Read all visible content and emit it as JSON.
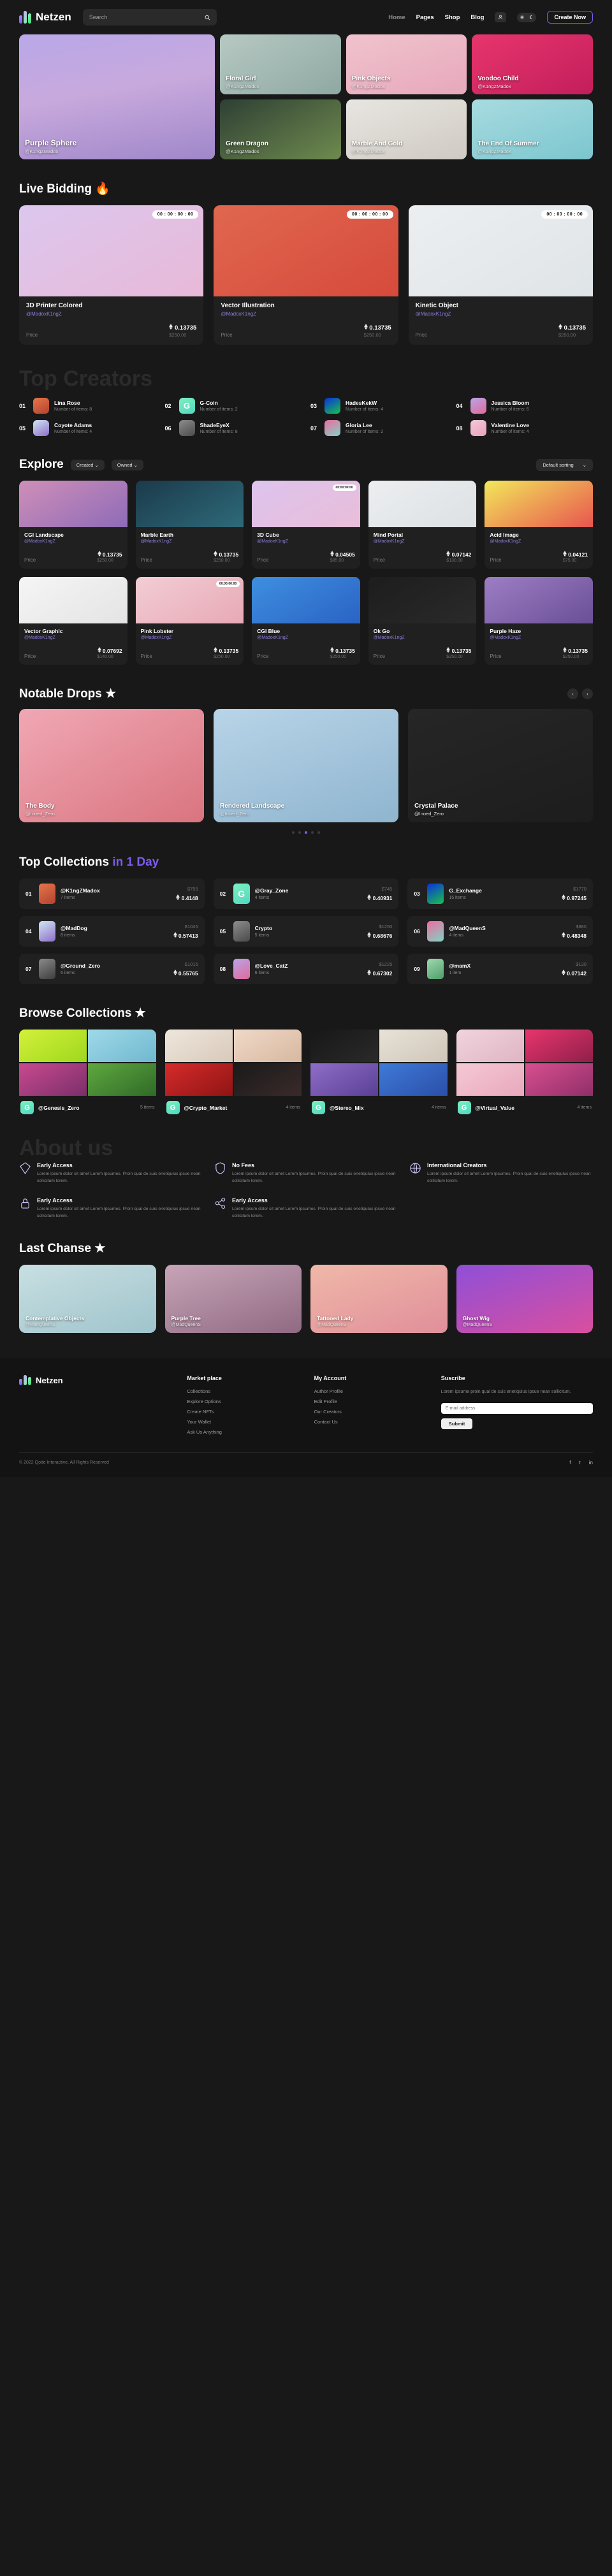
{
  "brand": {
    "name": "Netzen"
  },
  "search": {
    "placeholder": "Search",
    "value": "",
    "icon": "search-icon"
  },
  "nav": {
    "items": [
      {
        "label": "Home",
        "active": true
      },
      {
        "label": "Pages"
      },
      {
        "label": "Shop"
      },
      {
        "label": "Blog"
      }
    ],
    "user_icon": "user-icon",
    "theme_sun": "☀",
    "theme_moon": "☾",
    "cta": "Create Now"
  },
  "hero": {
    "cards": [
      {
        "title": "Purple Sphere",
        "author": "@K1ngZMadox",
        "bg": "linear-gradient(170deg,#b9a8e8,#c8a9dd 45%,#9f87c9)"
      },
      {
        "title": "Floral Girl",
        "author": "@K1ngZMadox",
        "bg": "linear-gradient(150deg,#b7c9c2,#8fa8a3)"
      },
      {
        "title": "Pink Objects",
        "author": "@K1ngZMadox",
        "bg": "linear-gradient(160deg,#f0c3ce,#e7a8bb)"
      },
      {
        "title": "Voodoo Child",
        "author": "@K1ngZMadox",
        "bg": "linear-gradient(150deg,#e8356d,#c21e5b)"
      },
      {
        "title": "Green Dragon",
        "author": "@K1ngZMadox",
        "bg": "linear-gradient(150deg,#2e4034,#6f8a4e)"
      },
      {
        "title": "Marble And Gold",
        "author": "@K1ngZMadox",
        "bg": "linear-gradient(160deg,#e8e6e2,#cfcac2)"
      },
      {
        "title": "The End Of Summer",
        "author": "@K1ngZMadox",
        "bg": "linear-gradient(160deg,#a8dbe0,#7cc6cf)"
      }
    ]
  },
  "live_bidding": {
    "title": "Live Bidding",
    "emoji": "🔥",
    "price_label": "Price",
    "items": [
      {
        "name": "3D Printer Colored",
        "author": "@MadoxK1ngZ",
        "timer": "00 : 00 : 00 : 00",
        "eth": "0.13735",
        "usd": "$250.00",
        "bg": "linear-gradient(150deg,#dcc7ee,#e8b9d8)"
      },
      {
        "name": "Vector Illustration",
        "author": "@MadoxK1ngZ",
        "timer": "00 : 00 : 00 : 00",
        "eth": "0.13735",
        "usd": "$250.00",
        "bg": "linear-gradient(150deg,#e0674f,#d64a3c)"
      },
      {
        "name": "Kinetic Object",
        "author": "@MadoxK1ngZ",
        "timer": "00 : 00 : 00 : 00",
        "eth": "0.13735",
        "usd": "$250.00",
        "bg": "linear-gradient(150deg,#eceff1,#dfe4e7)"
      }
    ]
  },
  "top_creators": {
    "title": "Top Creators",
    "items_prefix": "Number of items: ",
    "list": [
      {
        "rank": "01",
        "name": "Lina Rose",
        "items": "8",
        "av": "linear-gradient(150deg,#e8754a,#b0432f)",
        "ch": ""
      },
      {
        "rank": "02",
        "name": "G-Coin",
        "items": "2",
        "av": "linear-gradient(150deg,#7ef0c0,#4fd8c0)",
        "ch": "G"
      },
      {
        "rank": "03",
        "name": "HadesKekW",
        "items": "4",
        "av": "linear-gradient(150deg,#0a2fe0,#19c24a)",
        "ch": ""
      },
      {
        "rank": "04",
        "name": "Jessica Bloom",
        "items": "6",
        "av": "linear-gradient(150deg,#b9a4e8,#e06a9a)",
        "ch": ""
      },
      {
        "rank": "05",
        "name": "Coyote Adams",
        "items": "4",
        "av": "linear-gradient(150deg,#cfe7f5,#8f6ec8)",
        "ch": ""
      },
      {
        "rank": "06",
        "name": "ShadeEyeX",
        "items": "8",
        "av": "linear-gradient(150deg,#8d8d8d,#4a4a4a)",
        "ch": ""
      },
      {
        "rank": "07",
        "name": "Gloria Lee",
        "items": "2",
        "av": "linear-gradient(150deg,#ef6ba0,#7fd4c4)",
        "ch": ""
      },
      {
        "rank": "08",
        "name": "Valentine Love",
        "items": "4",
        "av": "linear-gradient(150deg,#f3c9d8,#e8a0bd)",
        "ch": ""
      }
    ]
  },
  "explore": {
    "title": "Explore",
    "filters": [
      {
        "label": "Created ⌄"
      },
      {
        "label": "Owned ⌄"
      }
    ],
    "sort": "Default sorting",
    "sort_caret": "⌄",
    "price_label": "Price",
    "items": [
      {
        "name": "CGI Landscape",
        "author": "@MadoxK1ngZ",
        "eth": "0.13735",
        "usd": "$250.00",
        "bg": "linear-gradient(150deg,#cf8fb8,#8e6bb8)",
        "timer": ""
      },
      {
        "name": "Marble Earth",
        "author": "@MadoxK1ngZ",
        "eth": "0.13735",
        "usd": "$250.00",
        "bg": "linear-gradient(150deg,#1b3a4a,#2e6a7a)",
        "timer": ""
      },
      {
        "name": "3D Cube",
        "author": "@MadoxK1ngZ",
        "eth": "0.04505",
        "usd": "$85.00",
        "bg": "linear-gradient(150deg,#ddc4ee,#e9bdd8)",
        "timer": "00:00:00:00"
      },
      {
        "name": "Mind Portal",
        "author": "@MadoxK1ngZ",
        "eth": "0.07142",
        "usd": "$130.00",
        "bg": "linear-gradient(150deg,#eceef0,#dde1e4)",
        "timer": ""
      },
      {
        "name": "Acid Image",
        "author": "@MadoxK1ngZ",
        "eth": "0.04121",
        "usd": "$75.00",
        "bg": "linear-gradient(150deg,#f2e85a,#e8554f)",
        "timer": ""
      },
      {
        "name": "Vector Graphic",
        "author": "@MadoxK1ngZ",
        "eth": "0.07692",
        "usd": "$140.00",
        "bg": "linear-gradient(150deg,#f5f5f5,#e4e4e4)",
        "timer": ""
      },
      {
        "name": "Pink Lobster",
        "author": "@MadoxK1ngZ",
        "eth": "0.13735",
        "usd": "$250.00",
        "bg": "linear-gradient(150deg,#f3cdd4,#e7a9b6)",
        "timer": "00:00:00:00"
      },
      {
        "name": "CGI Blue",
        "author": "@MadoxK1ngZ",
        "eth": "0.13735",
        "usd": "$250.00",
        "bg": "linear-gradient(150deg,#3e8fe0,#2a63c4)",
        "timer": ""
      },
      {
        "name": "Ok Go",
        "author": "@MadoxK1ngZ",
        "eth": "0.13735",
        "usd": "$250.00",
        "bg": "linear-gradient(150deg,#1d1d1d,#2a2a2a)",
        "timer": ""
      },
      {
        "name": "Purple Haze",
        "author": "@MadoxK1ngZ",
        "eth": "0.13735",
        "usd": "$250.00",
        "bg": "linear-gradient(150deg,#9d7ec4,#6a4f96)",
        "timer": ""
      }
    ]
  },
  "notable_drops": {
    "title": "Notable Drops",
    "emoji": "★",
    "prev": "‹",
    "next": "›",
    "items": [
      {
        "title": "The Body",
        "author": "@Inoed_Zero",
        "bg": "linear-gradient(150deg,#f0a8b4,#d9747f)"
      },
      {
        "title": "Rendered Landscape",
        "author": "@Inoed_Zero",
        "bg": "linear-gradient(160deg,#b8d4e8,#8fb5cf)"
      },
      {
        "title": "Crystal Palace",
        "author": "@Inoed_Zero",
        "bg": "linear-gradient(160deg,#262626,#1d1d1d)"
      }
    ],
    "dots": 5,
    "active_dot": 2
  },
  "top_collections": {
    "title": "Top Collections",
    "title_accent": "in 1 Day",
    "items_suffix": " items",
    "rows": [
      {
        "rank": "01",
        "name": "@K1ngZMadox",
        "items": "7 items",
        "usd": "$755",
        "eth": "0.4148",
        "av": "linear-gradient(150deg,#e8754a,#b0432f)",
        "ch": ""
      },
      {
        "rank": "02",
        "name": "@Gray_Zone",
        "items": "4 items",
        "usd": "$745",
        "eth": "0.40931",
        "av": "linear-gradient(150deg,#7ef0c0,#4fd8c0)",
        "ch": "G"
      },
      {
        "rank": "03",
        "name": "G_Exchange",
        "items": "15 items",
        "usd": "$1770",
        "eth": "0.97245",
        "av": "linear-gradient(150deg,#0a2fe0,#19c24a)",
        "ch": ""
      },
      {
        "rank": "04",
        "name": "@MadDog",
        "items": "8 items",
        "usd": "$1045",
        "eth": "0.57413",
        "av": "linear-gradient(150deg,#cfe7f5,#8f6ec8)",
        "ch": ""
      },
      {
        "rank": "05",
        "name": "Crypto",
        "items": "5 items",
        "usd": "$1250",
        "eth": "0.68676",
        "av": "linear-gradient(150deg,#8d8d8d,#4a4a4a)",
        "ch": ""
      },
      {
        "rank": "06",
        "name": "@MadQueenS",
        "items": "4 items",
        "usd": "$880",
        "eth": "0.48348",
        "av": "linear-gradient(150deg,#ef6ba0,#7fd4c4)",
        "ch": ""
      },
      {
        "rank": "07",
        "name": "@Ground_Zero",
        "items": "6 items",
        "usd": "$1015",
        "eth": "0.55765",
        "av": "linear-gradient(150deg,#8a8a8a,#3d3d3d)",
        "ch": ""
      },
      {
        "rank": "08",
        "name": "@Love_CatZ",
        "items": "6 items",
        "usd": "$1225",
        "eth": "0.67302",
        "av": "linear-gradient(150deg,#b9a4e8,#e06a9a)",
        "ch": ""
      },
      {
        "rank": "09",
        "name": "@mamX",
        "items": "1 item",
        "usd": "$130",
        "eth": "0.07142",
        "av": "linear-gradient(150deg,#9fd9b0,#4f9e6a)",
        "ch": ""
      }
    ]
  },
  "browse_collections": {
    "title": "Browse Collections",
    "emoji": "★",
    "items": [
      {
        "name": "@Genesis_Zero",
        "count": "5 items",
        "av": "linear-gradient(150deg,#7ef0c0,#4fd8c0)",
        "ch": "G",
        "tiles": [
          "linear-gradient(150deg,#d4f03a,#9ed81e)",
          "linear-gradient(150deg,#9fd9e8,#6fb8cf)",
          "linear-gradient(150deg,#c94a8f,#7a2f6a)",
          "linear-gradient(150deg,#5fa83f,#2f6a28)"
        ]
      },
      {
        "name": "@Crypto_Market",
        "count": "4 items",
        "av": "linear-gradient(150deg,#7ef0c0,#4fd8c0)",
        "ch": "G",
        "tiles": [
          "linear-gradient(150deg,#efe6dc,#d8cabb)",
          "linear-gradient(150deg,#efd9c8,#d8b8a0)",
          "linear-gradient(150deg,#d62b2b,#8f1414)",
          "linear-gradient(150deg,#1a1a1a,#3a2a2a)"
        ]
      },
      {
        "name": "@Stereo_Mix",
        "count": "4 items",
        "av": "linear-gradient(150deg,#7ef0c0,#4fd8c0)",
        "ch": "G",
        "tiles": [
          "linear-gradient(150deg,#171717,#2a2a2a)",
          "linear-gradient(150deg,#e8e2d8,#cfc6b8)",
          "linear-gradient(150deg,#8f6ec8,#5a3f96)",
          "linear-gradient(150deg,#3f7ad8,#2a4fa8)"
        ]
      },
      {
        "name": "@Virtual_Value",
        "count": "4 items",
        "av": "linear-gradient(150deg,#7ef0c0,#4fd8c0)",
        "ch": "G",
        "tiles": [
          "linear-gradient(150deg,#f0d4dd,#e0b4c4)",
          "linear-gradient(150deg,#e8356d,#8f1f4a)",
          "linear-gradient(150deg,#f5c9d4,#e8a8bd)",
          "linear-gradient(150deg,#d94f8f,#8f2f6a)"
        ]
      }
    ]
  },
  "about": {
    "title": "About us",
    "items": [
      {
        "icon": "diamond-icon",
        "title": "Early Access",
        "desc": "Lorem ipsum dolor sit amet Lorem Ipsumes. Proin qual de suis enetiqulus ipsue nean sollicitum lorem."
      },
      {
        "icon": "shield-icon",
        "title": "No Fees",
        "desc": "Lorem ipsum dolor sit amet Lorem Ipsumes. Proin qual de suis enetiqulus ipsue nean sollicitum lorem."
      },
      {
        "icon": "globe-icon",
        "title": "International Creators",
        "desc": "Lorem ipsum dolor sit amet Lorem Ipsumes. Proin qual de suis enetiqulus ipsue nean sollicitum lorem."
      },
      {
        "icon": "lock-icon",
        "title": "Early Access",
        "desc": "Lorem ipsum dolor sit amet Lorem Ipsumes. Proin qual de suis enetiqulus ipsue nean sollicitum lorem."
      },
      {
        "icon": "share-icon",
        "title": "Early Access",
        "desc": "Lorem ipsum dolor sit amet Lorem Ipsumes. Proin qual de suis enetiqulus ipsue nean sollicitum lorem."
      }
    ]
  },
  "last_chance": {
    "title": "Last Chanse",
    "emoji": "★",
    "items": [
      {
        "title": "Contemplative Objects",
        "author": "@MadQueenS",
        "bg": "linear-gradient(160deg,#c8dfe2,#9fc4cc)"
      },
      {
        "title": "Purple Tree",
        "author": "@MadQueenS",
        "bg": "linear-gradient(160deg,#c8a4b8,#8f6a82)"
      },
      {
        "title": "Tattooed Lady",
        "author": "@MadQueenS",
        "bg": "linear-gradient(160deg,#f0b8a8,#e08f9a)"
      },
      {
        "title": "Ghost Wig",
        "author": "@MadQueenS",
        "bg": "linear-gradient(160deg,#8f4fd8,#d94f9f)"
      }
    ]
  },
  "footer": {
    "brand": "Netzen",
    "cols": [
      {
        "title": "Market place",
        "links": [
          "Collections",
          "Explore Options",
          "Create NFTs",
          "Your Wallet",
          "Ask Us Anything"
        ]
      },
      {
        "title": "My Account",
        "links": [
          "Author Profile",
          "Edit Profile",
          "Our Creators",
          "Contact Us"
        ]
      }
    ],
    "subscribe": {
      "title": "Suscribe",
      "desc": "Lorem ipsume proin qual de suis enetiqulus ipsue nean sollicitum.",
      "placeholder": "E-mail address",
      "button": "Submit"
    },
    "copyright": "© 2022 Qode Interactive, All Rights Reserved",
    "socials": [
      "f",
      "t",
      "in"
    ]
  }
}
